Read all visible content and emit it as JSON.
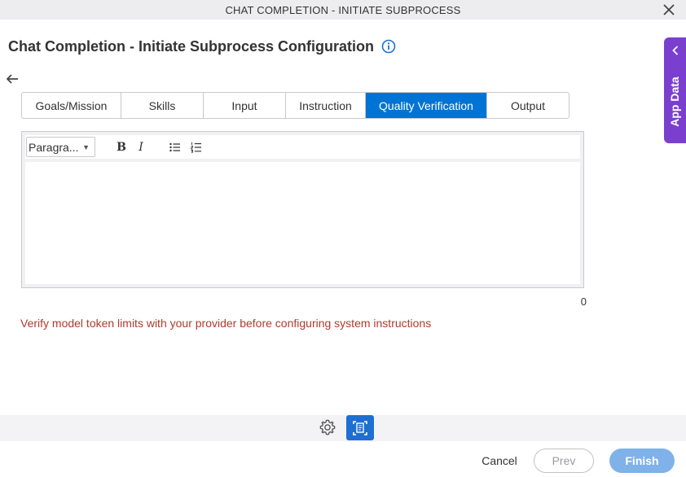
{
  "window": {
    "title": "CHAT COMPLETION - INITIATE SUBPROCESS"
  },
  "page": {
    "title": "Chat Completion - Initiate Subprocess Configuration"
  },
  "tabs": [
    {
      "label": "Goals/Mission",
      "active": false
    },
    {
      "label": "Skills",
      "active": false
    },
    {
      "label": "Input",
      "active": false
    },
    {
      "label": "Instruction",
      "active": false
    },
    {
      "label": "Quality Verification",
      "active": true
    },
    {
      "label": "Output",
      "active": false
    }
  ],
  "editor": {
    "format_select": "Paragra...",
    "bold_label": "B",
    "italic_label": "I",
    "content": "",
    "char_count": "0"
  },
  "warning": "Verify model token limits with your provider before configuring system instructions",
  "footer": {
    "cancel_label": "Cancel",
    "prev_label": "Prev",
    "finish_label": "Finish"
  },
  "side_panel": {
    "label": "App Data"
  },
  "colors": {
    "accent": "#0074d4",
    "side_panel": "#7b3fcf",
    "warning": "#b03a2e",
    "finish_button": "#7fb2e8"
  },
  "icons": {
    "close": "close-icon",
    "info": "info-icon",
    "back": "arrow-left-icon",
    "bulleted_list": "bulleted-list-icon",
    "numbered_list": "numbered-list-icon",
    "gear": "gear-icon",
    "document": "document-icon",
    "chevron": "chevron-left-icon"
  }
}
